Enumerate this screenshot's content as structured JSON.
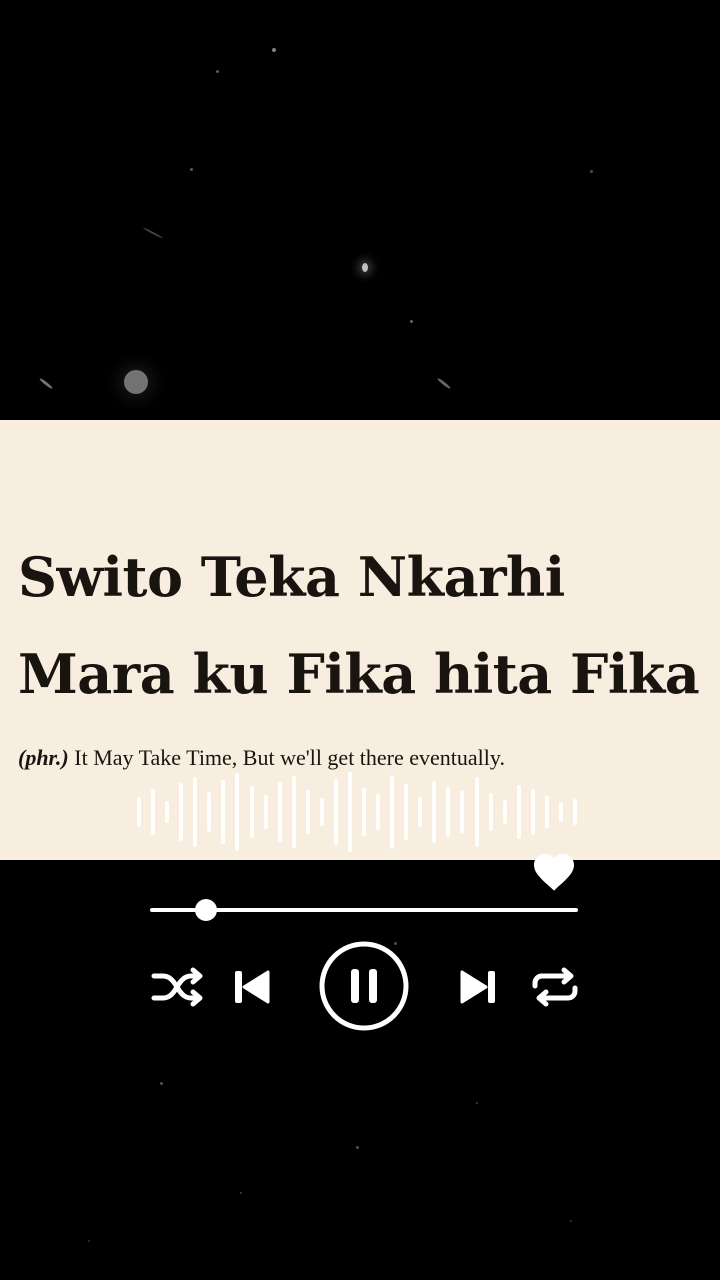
{
  "lyric": {
    "line1": "Swito Teka Nkarhi",
    "line2": "Mara ku Fika hita Fika",
    "definition_tag": "(phr.)",
    "definition_text": " It May Take Time, But we'll get there eventually."
  },
  "player": {
    "progress": 0.13,
    "is_playing": true,
    "liked": true
  },
  "icons": {
    "like": "heart-icon",
    "shuffle": "shuffle-icon",
    "previous": "skip-previous-icon",
    "play_pause": "pause-icon",
    "next": "skip-next-icon",
    "repeat": "repeat-icon"
  },
  "colors": {
    "background": "#000000",
    "card": "#f7eedf",
    "text": "#1a1410",
    "controls": "#ffffff"
  }
}
